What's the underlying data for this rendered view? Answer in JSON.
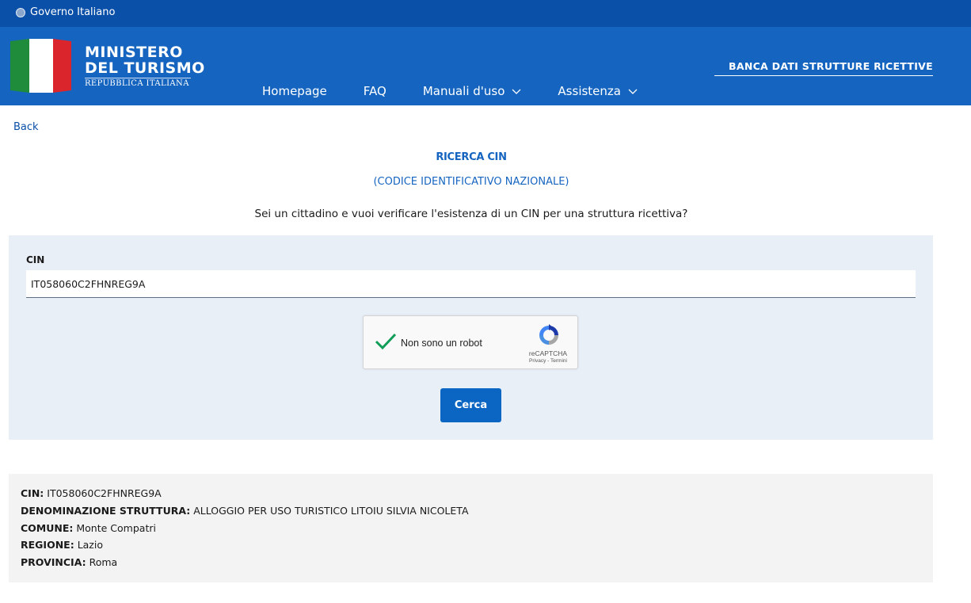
{
  "topbar": {
    "gov_label": "Governo Italiano"
  },
  "header": {
    "logo_line1": "MINISTERO",
    "logo_line2": "DEL TURISMO",
    "logo_line3": "REPUBBLICA ITALIANA",
    "db_title": "BANCA DATI STRUTTURE RICETTIVE",
    "nav": [
      {
        "label": "Homepage"
      },
      {
        "label": "FAQ"
      },
      {
        "label": "Manuali d'uso"
      },
      {
        "label": "Assistenza"
      }
    ]
  },
  "colors": {
    "topbar": "#0a4fa8",
    "header": "#1565c0",
    "accent": "#0a66c2",
    "form_bg": "#e9eff7",
    "result_bg": "#f3f3f3"
  },
  "back_label": "Back",
  "page": {
    "title": "RICERCA CIN",
    "subtitle": "(CODICE IDENTIFICATIVO NAZIONALE)",
    "question": "Sei un cittadino e vuoi verificare l'esistenza di un CIN per una struttura ricettiva?"
  },
  "form": {
    "cin_label": "CIN",
    "cin_value": "IT058060C2FHNREG9A",
    "captcha_label": "Non sono un robot",
    "captcha_brand": "reCAPTCHA",
    "captcha_links": "Privacy - Termini",
    "captcha_checked": true,
    "search_button": "Cerca"
  },
  "result": {
    "rows": [
      {
        "label": "CIN:",
        "value": "IT058060C2FHNREG9A"
      },
      {
        "label": "DENOMINAZIONE STRUTTURA:",
        "value": "ALLOGGIO PER USO TURISTICO LITOIU SILVIA NICOLETA"
      },
      {
        "label": "COMUNE:",
        "value": "Monte Compatri"
      },
      {
        "label": "REGIONE:",
        "value": "Lazio"
      },
      {
        "label": "PROVINCIA:",
        "value": "Roma"
      }
    ]
  },
  "icons": {
    "gov": "emblem-icon",
    "nav_chevron": "chevron-down-icon",
    "captcha_check": "checkmark-icon",
    "captcha_logo": "recaptcha-logo-icon"
  }
}
